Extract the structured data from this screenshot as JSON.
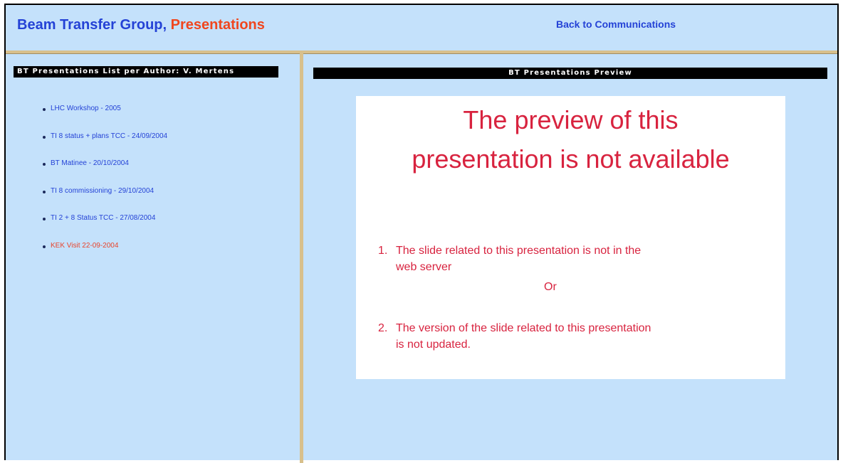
{
  "header": {
    "title_main": "Beam Transfer Group,",
    "title_accent": "Presentations",
    "back_link": "Back to Communications"
  },
  "left_panel": {
    "heading": "BT Presentations List per Author: V. Mertens",
    "items": [
      {
        "label": "LHC Workshop - 2005",
        "active": false
      },
      {
        "label": "TI 8 status + plans TCC - 24/09/2004",
        "active": false
      },
      {
        "label": "BT Matinee - 20/10/2004",
        "active": false
      },
      {
        "label": "TI 8 commissioning - 29/10/2004",
        "active": false
      },
      {
        "label": "TI 2 + 8 Status TCC - 27/08/2004",
        "active": false
      },
      {
        "label": "KEK Visit 22-09-2004",
        "active": true
      }
    ]
  },
  "right_panel": {
    "heading": "BT Presentations Preview",
    "preview": {
      "title_line1": "The preview of this",
      "title_line2": "presentation is not available",
      "reason1_num": "1.",
      "reason1_line1": "The slide related to this presentation is not in the",
      "reason1_line2": "web server",
      "or_text": "Or",
      "reason2_num": "2.",
      "reason2_line1": "The version of the slide related to this presentation",
      "reason2_line2": "is not updated."
    }
  },
  "colors": {
    "background": "#c4e1fb",
    "link_blue": "#2442d6",
    "accent_red": "#f0461e",
    "preview_red": "#d8233f",
    "separator": "#d8c08c"
  }
}
